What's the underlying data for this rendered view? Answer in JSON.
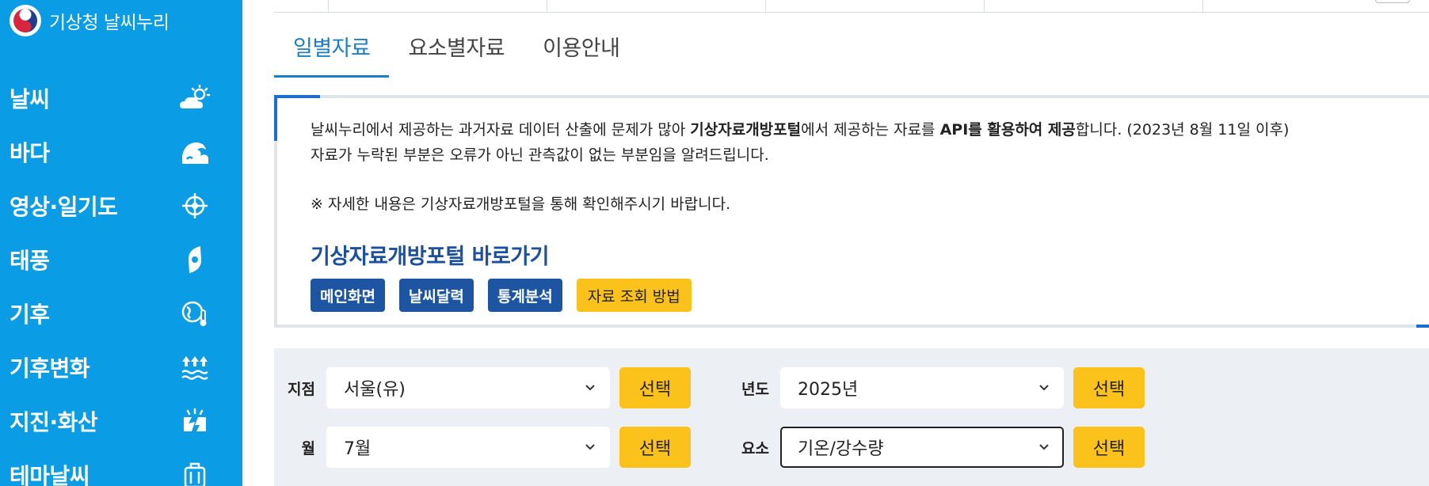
{
  "brand": {
    "name": "기상청 날씨누리",
    "logo_icon": "taegeuk-emblem-icon"
  },
  "sidebar": {
    "background": "#0a9de5",
    "items": [
      {
        "label": "날씨",
        "icon": "sun-cloud-icon"
      },
      {
        "label": "바다",
        "icon": "wave-icon"
      },
      {
        "label": "영상·일기도",
        "icon": "satellite-target-icon"
      },
      {
        "label": "태풍",
        "icon": "typhoon-icon"
      },
      {
        "label": "기후",
        "icon": "globe-thermometer-icon"
      },
      {
        "label": "기후변화",
        "icon": "rising-water-icon"
      },
      {
        "label": "지진·화산",
        "icon": "earthquake-icon"
      },
      {
        "label": "테마날씨",
        "icon": "suitcase-icon"
      }
    ]
  },
  "tabs": [
    {
      "label": "일별자료",
      "active": true
    },
    {
      "label": "요소별자료",
      "active": false
    },
    {
      "label": "이용안내",
      "active": false
    }
  ],
  "notice": {
    "line1_a": "날씨누리에서 제공하는 과거자료 데이터 산출에 문제가 많아 ",
    "line1_b": "기상자료개방포털",
    "line1_c": "에서 제공하는 자료를 ",
    "line1_d": "API를 활용하여 제공",
    "line1_e": "합니다. (2023년 8월 11일 이후)",
    "line2": "자료가 누락된 부분은 오류가 아닌 관측값이 없는 부분임을 알려드립니다.",
    "line3": "※ 자세한 내용은 기상자료개방포털을 통해 확인해주시기 바랍니다.",
    "portal_title": "기상자료개방포털 바로가기",
    "buttons": [
      "메인화면",
      "날씨달력",
      "통계분석"
    ],
    "help_button": "자료 조회 방법"
  },
  "form": {
    "station": {
      "label": "지점",
      "value": "서울(유)",
      "button": "선택"
    },
    "year": {
      "label": "년도",
      "value": "2025년",
      "button": "선택"
    },
    "month": {
      "label": "월",
      "value": "7월",
      "button": "선택"
    },
    "element": {
      "label": "요소",
      "value": "기온/강수량",
      "button": "선택"
    }
  },
  "colors": {
    "accent": "#1a7ec9",
    "primary_button": "#1d55a3",
    "yellow_button": "#fbc21b"
  }
}
